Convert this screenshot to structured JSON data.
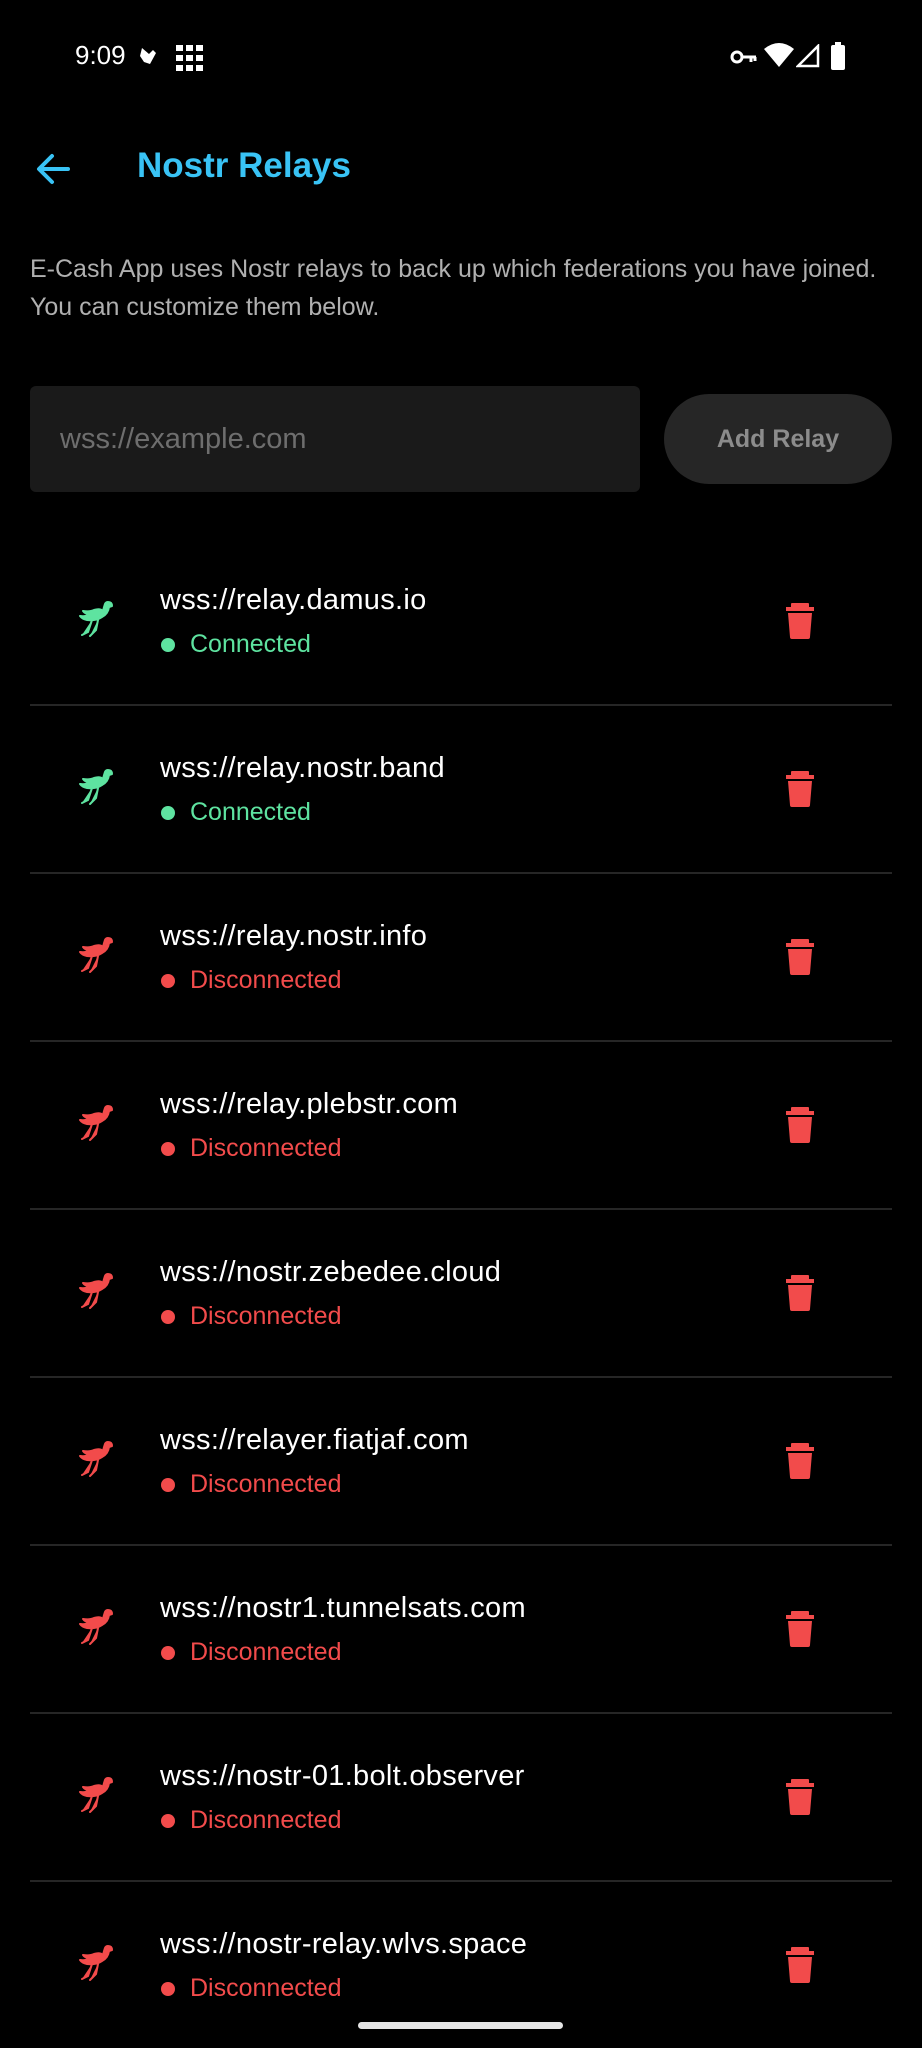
{
  "status_bar": {
    "time": "9:09",
    "icons": [
      "notification-icon",
      "grid-icon",
      "vpn-key-icon",
      "wifi-icon",
      "signal-icon",
      "battery-icon"
    ]
  },
  "header": {
    "back_icon": "arrow-left-icon",
    "title": "Nostr Relays"
  },
  "description": "E-Cash App uses Nostr relays to back up which federations you have joined. You can customize them below.",
  "add_relay": {
    "placeholder": "wss://example.com",
    "value": "",
    "button_label": "Add Relay"
  },
  "colors": {
    "accent": "#39c3f5",
    "connected": "#5ee3a0",
    "disconnected": "#f24b4b",
    "delete": "#f24b4b"
  },
  "relays": [
    {
      "url": "wss://relay.damus.io",
      "status": "Connected",
      "connected": true
    },
    {
      "url": "wss://relay.nostr.band",
      "status": "Connected",
      "connected": true
    },
    {
      "url": "wss://relay.nostr.info",
      "status": "Disconnected",
      "connected": false
    },
    {
      "url": "wss://relay.plebstr.com",
      "status": "Disconnected",
      "connected": false
    },
    {
      "url": "wss://nostr.zebedee.cloud",
      "status": "Disconnected",
      "connected": false
    },
    {
      "url": "wss://relayer.fiatjaf.com",
      "status": "Disconnected",
      "connected": false
    },
    {
      "url": "wss://nostr1.tunnelsats.com",
      "status": "Disconnected",
      "connected": false
    },
    {
      "url": "wss://nostr-01.bolt.observer",
      "status": "Disconnected",
      "connected": false
    },
    {
      "url": "wss://nostr-relay.wlvs.space",
      "status": "Disconnected",
      "connected": false
    }
  ]
}
